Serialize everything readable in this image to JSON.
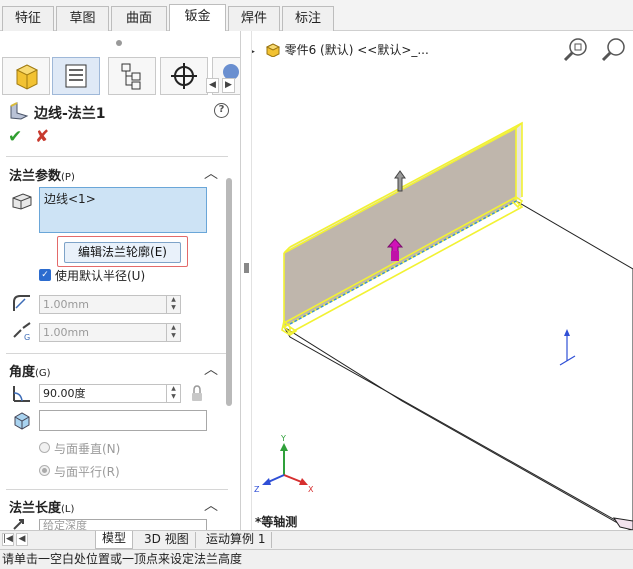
{
  "top_tabs": [
    "特征",
    "草图",
    "曲面",
    "钣金",
    "焊件",
    "标注"
  ],
  "active_top_tab": "钣金",
  "panel": {
    "title": "边线-法兰1",
    "help": "?",
    "ok": "✔",
    "cancel": "✘"
  },
  "params": {
    "header": "法兰参数",
    "header_key": "(P)",
    "edge_item": "边线<1>",
    "edit_button": "编辑法兰轮廓(E)",
    "use_default_radius": "使用默认半径(U)",
    "radius_value": "1.00mm",
    "gap_value": "1.00mm"
  },
  "angle": {
    "header": "角度",
    "header_key": "(G)",
    "value": "90.00度",
    "perpendicular": "与面垂直(N)",
    "parallel": "与面平行(R)"
  },
  "length": {
    "header": "法兰长度",
    "header_key": "(L)",
    "partial": "给定深度"
  },
  "tree": {
    "item": "零件6 (默认) <<默认>_..."
  },
  "view_name": "*等轴测",
  "bottom_tabs": [
    "模型",
    "3D 视图",
    "运动算例 1"
  ],
  "status": "请单击一空白处位置或一顶点来设定法兰高度",
  "triad": {
    "x": "X",
    "y": "Y",
    "z": "Z"
  },
  "colors": {
    "selection_yellow": "#f2f233",
    "flange_face": "#bfb6ac",
    "accent_blue": "#2c6ccf",
    "triad_x": "#d62f2f",
    "triad_y": "#2fa03a",
    "triad_z": "#2f4fd6"
  }
}
